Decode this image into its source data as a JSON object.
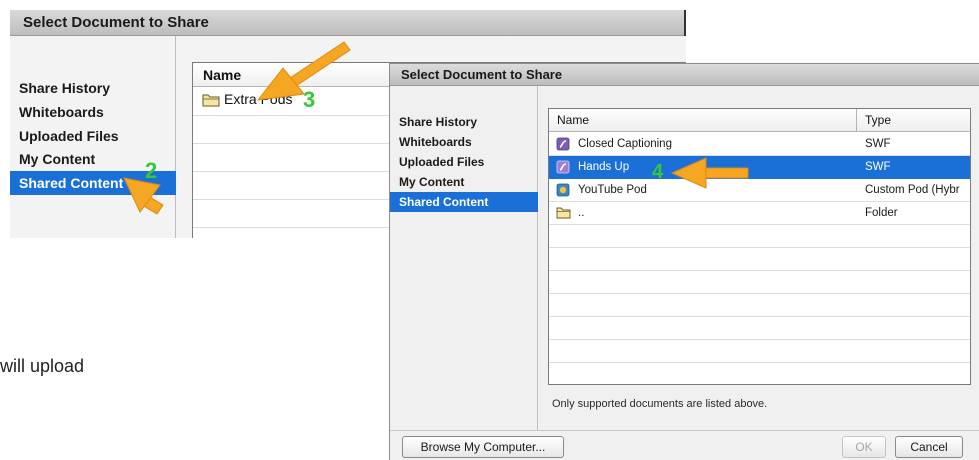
{
  "dialog_back": {
    "title": "Select Document to Share",
    "nav": [
      "Share History",
      "Whiteboards",
      "Uploaded Files",
      "My Content",
      "Shared Content"
    ],
    "selected_nav": 4,
    "list_header": "Name",
    "rows": [
      {
        "name": "Extra Pods",
        "icon": "folder-icon"
      }
    ]
  },
  "dialog_front": {
    "title": "Select Document to Share",
    "nav": [
      "Share History",
      "Whiteboards",
      "Uploaded Files",
      "My Content",
      "Shared Content"
    ],
    "selected_nav": 4,
    "columns": {
      "name": "Name",
      "type": "Type"
    },
    "rows": [
      {
        "name": "Closed Captioning",
        "type": "SWF",
        "icon": "swf-icon"
      },
      {
        "name": "Hands Up",
        "type": "SWF",
        "icon": "swf-icon",
        "selected": true
      },
      {
        "name": "YouTube Pod",
        "type": "Custom Pod (Hybr",
        "icon": "custom-pod-icon"
      },
      {
        "name": "..",
        "type": "Folder",
        "icon": "folder-icon"
      }
    ],
    "hint": "Only supported documents are listed above.",
    "buttons": {
      "browse": "Browse My Computer...",
      "ok": "OK",
      "cancel": "Cancel"
    }
  },
  "annotations": {
    "step2": "2",
    "step3": "3",
    "step4": "4",
    "partial_text": "will upload",
    "arrow_color": "#f5a623",
    "number_color": "#37c837"
  },
  "colors": {
    "selection": "#1b70d8"
  }
}
